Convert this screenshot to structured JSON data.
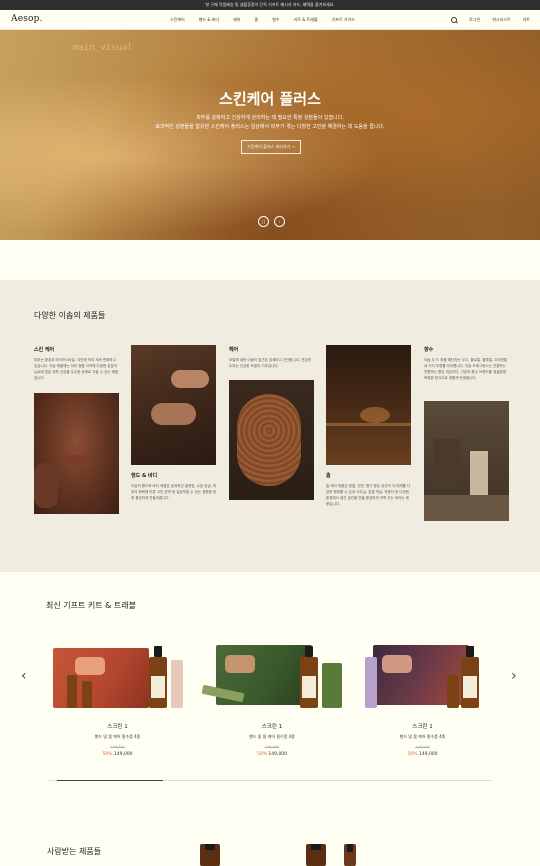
{
  "promo_bar": "첫 구매 작품배송 및 샘플증정이 단독 기프트 메시지 카드, 혜택을 즐겨보세요.",
  "header": {
    "logo": "Aesop.",
    "nav": [
      "스킨케어",
      "핸드 & 바디",
      "헤어",
      "홈",
      "향수",
      "키트 & 트래블",
      "기프트 가이드"
    ],
    "login": "로그인",
    "wishlist": "위시리스트",
    "cart": "카트"
  },
  "hero": {
    "tag": "main_visual",
    "title": "스킨케어 플러스",
    "line1": "피부를 강화하고 건강하게 관리하는 데 필요한 특정 성분들이 있습니다.",
    "line2": "효과적인 성분들을 함유한 스킨케어 플러스는 일상에서 피부가 겪는 다양한 고민을 해결하는 데 도움을 줍니다.",
    "cta": "스킨케어 플러스 보러가기 →",
    "pause_symbol": "||",
    "next_symbol": "›"
  },
  "categories_section": {
    "title": "다양한 이솝의 제품들",
    "items": [
      {
        "name": "스킨 케어",
        "desc": "피부는 환경과 라이프스타일, 식단에 따라 계속 변화하고 있습니다. 이솝 제품에는 여러 정품 고려해 다양한 성분과 뉴트레 맞춘 피부 건강을 우수한 상태로 가꿀 수 있는 제품입니다."
      },
      {
        "name": "핸드 & 바디",
        "desc": "이솝의 핸드와 바디 제품은 효과적인 클렌징, 수분 공급, 피부의 회복에 따른 고민 영역 등 일상적일 수 있는 경험을 한층 풍성하게 만들어줍니다."
      },
      {
        "name": "헤어",
        "desc": "모발에 대한 이솝의 접근은 섬세하고 간단합니다. 건강한 두피는 건강한 모발의 기초입니다."
      },
      {
        "name": "홈",
        "desc": "홈 케어 제품은 청결, 건전, 향기 향유 공간의 각 미래를 다양한 행위를 수 있게 사무실, 호텔 객실, 자동차 등 다양한 환경에서 생긴 공간을 만들 풍성하게 꾸며 주는 바라는 제품입니다."
      },
      {
        "name": "향수",
        "desc": "이솝 우 드 퍼퓸 예단자는 우디, 플로럴, 플루랄, 오리엔탈 네 가지 부류를 아우릅니다. 이솝 프래그런스는 관찰하는 전향하는 향은 개성이다, 기존의 향수 브랜드를 재설립해 독특한 방식으로 새롭게 탄생됩니다."
      }
    ]
  },
  "gift_section": {
    "title": "최신 기프트 키트 & 트래블",
    "prev_symbol": "‹",
    "next_symbol": "›",
    "products": [
      {
        "name": "스크린 1",
        "sub": "핸드 및 몸 케어 필수품 4종",
        "orig": "149,000",
        "disc": "50%",
        "price": "149,000"
      },
      {
        "name": "스크린 1",
        "sub": "핸드 및 몸 케어 필수품 4종",
        "orig": "149,000",
        "disc": "50%",
        "price": "149,000"
      },
      {
        "name": "스크린 1",
        "sub": "핸드 및 몸 케어 필수품 4종",
        "orig": "149,000",
        "disc": "50%",
        "price": "149,000"
      }
    ],
    "carousel_progress": 0.24
  },
  "loved_section": {
    "title": "사랑받는 제품들"
  }
}
